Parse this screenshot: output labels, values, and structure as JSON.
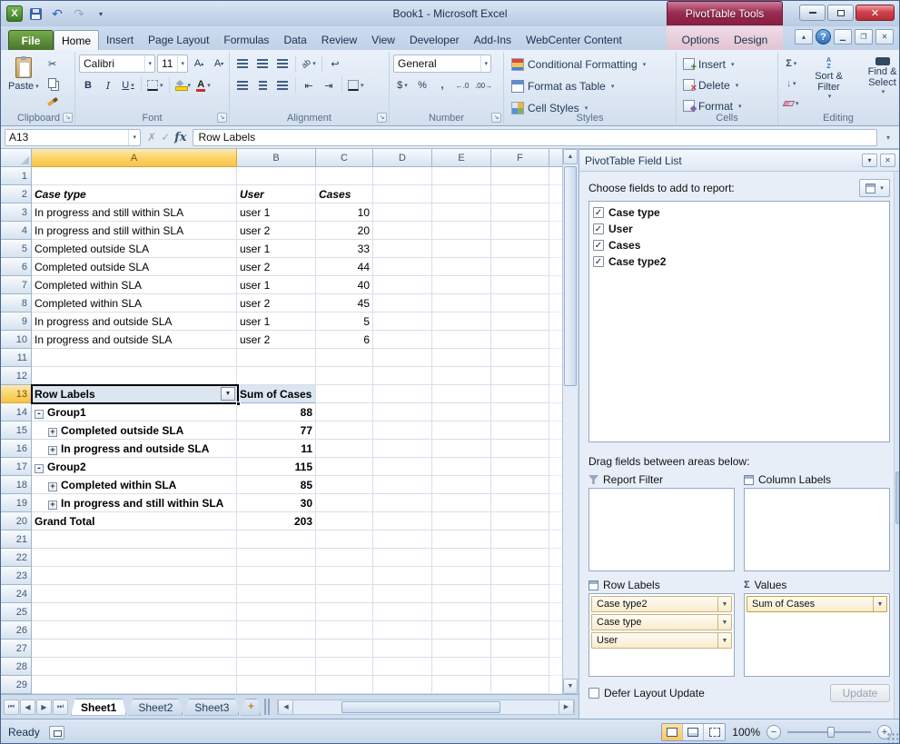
{
  "titlebar": {
    "title": "Book1 - Microsoft Excel",
    "context_group": "PivotTable Tools"
  },
  "tabs": {
    "file": "File",
    "main": [
      "Home",
      "Insert",
      "Page Layout",
      "Formulas",
      "Data",
      "Review",
      "View",
      "Developer",
      "Add-Ins",
      "WebCenter Content"
    ],
    "contextual": [
      "Options",
      "Design"
    ],
    "active": "Home"
  },
  "ribbon": {
    "clipboard": {
      "label": "Clipboard",
      "paste": "Paste"
    },
    "font": {
      "label": "Font",
      "name": "Calibri",
      "size": "11"
    },
    "alignment": {
      "label": "Alignment"
    },
    "number": {
      "label": "Number",
      "format": "General"
    },
    "styles": {
      "label": "Styles",
      "buttons": [
        "Conditional Formatting",
        "Format as Table",
        "Cell Styles"
      ]
    },
    "cells": {
      "label": "Cells",
      "buttons": [
        "Insert",
        "Delete",
        "Format"
      ]
    },
    "editing": {
      "label": "Editing",
      "sort_filter": "Sort & Filter",
      "find_select": "Find & Select"
    }
  },
  "formula_bar": {
    "cell_ref": "A13",
    "value": "Row Labels"
  },
  "sheet": {
    "col_headers": [
      "A",
      "B",
      "C",
      "D",
      "E",
      "F"
    ],
    "row_numbers": [
      1,
      2,
      3,
      4,
      5,
      6,
      7,
      8,
      9,
      10,
      11,
      12,
      13,
      14,
      15,
      16,
      17,
      18,
      19,
      20,
      21,
      22,
      23,
      24,
      25,
      26,
      27,
      28,
      29
    ],
    "source_table": {
      "headers": [
        "Case type",
        "User",
        "Cases"
      ],
      "rows": [
        [
          "In progress and still within SLA",
          "user 1",
          "10"
        ],
        [
          "In progress and still within SLA",
          "user 2",
          "20"
        ],
        [
          "Completed outside SLA",
          "user 1",
          "33"
        ],
        [
          "Completed outside SLA",
          "user 2",
          "44"
        ],
        [
          "Completed within SLA",
          "user 1",
          "40"
        ],
        [
          "Completed within SLA",
          "user 2",
          "45"
        ],
        [
          "In progress and outside SLA",
          "user 1",
          "5"
        ],
        [
          "In progress and outside SLA",
          "user 2",
          "6"
        ]
      ]
    },
    "pivot": {
      "header_label": "Row Labels",
      "header_value": "Sum of Cases",
      "rows": [
        {
          "label": "Group1",
          "value": "88",
          "glyph": "-"
        },
        {
          "label": "Completed outside SLA",
          "value": "77",
          "glyph": "+"
        },
        {
          "label": "In progress and outside SLA",
          "value": "11",
          "glyph": "+"
        },
        {
          "label": "Group2",
          "value": "115",
          "glyph": "-"
        },
        {
          "label": "Completed within SLA",
          "value": "85",
          "glyph": "+"
        },
        {
          "label": "In progress and still within SLA",
          "value": "30",
          "glyph": "+"
        },
        {
          "label": "Grand Total",
          "value": "203",
          "glyph": ""
        }
      ]
    }
  },
  "field_list": {
    "title": "PivotTable Field List",
    "choose_label": "Choose fields to add to report:",
    "fields": [
      {
        "name": "Case type",
        "checked": true
      },
      {
        "name": "User",
        "checked": true
      },
      {
        "name": "Cases",
        "checked": true
      },
      {
        "name": "Case type2",
        "checked": true
      }
    ],
    "drag_label": "Drag fields between areas below:",
    "areas": {
      "report_filter": {
        "title": "Report Filter",
        "items": []
      },
      "column_labels": {
        "title": "Column Labels",
        "items": []
      },
      "row_labels": {
        "title": "Row Labels",
        "items": [
          "Case type2",
          "Case type",
          "User"
        ]
      },
      "values": {
        "title": "Values",
        "items": [
          "Sum of Cases"
        ]
      }
    },
    "defer_label": "Defer Layout Update",
    "update_button": "Update"
  },
  "sheet_tabs": {
    "tabs": [
      "Sheet1",
      "Sheet2",
      "Sheet3"
    ],
    "active": "Sheet1"
  },
  "status_bar": {
    "ready": "Ready",
    "zoom": "100%"
  },
  "colors": {
    "context_accent": "#9a2d52",
    "file_tab_green": "#48752c",
    "header_selection": "#fbd264",
    "chip_fill": "#f8eccd",
    "titlebar_top": "#dbe7f5",
    "titlebar_bottom": "#b9cce2"
  }
}
